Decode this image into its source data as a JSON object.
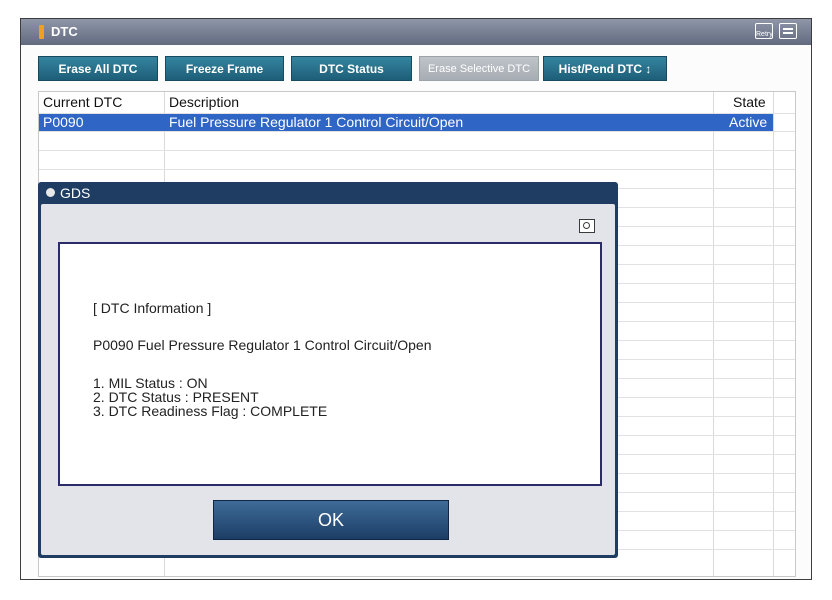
{
  "window": {
    "title": "DTC",
    "retry_icon_label": "Retry"
  },
  "toolbar": {
    "buttons": [
      {
        "label": "Erase All DTC",
        "enabled": true
      },
      {
        "label": "Freeze Frame",
        "enabled": true
      },
      {
        "label": "DTC Status",
        "enabled": true
      },
      {
        "label": "Erase Selective DTC",
        "enabled": false
      },
      {
        "label": "Hist/Pend DTC ↕",
        "enabled": true
      }
    ]
  },
  "table": {
    "columns": [
      "Current DTC",
      "Description",
      "State"
    ],
    "rows": [
      {
        "code": "P0090",
        "description": "Fuel Pressure Regulator 1 Control Circuit/Open",
        "state": "Active",
        "selected": true
      }
    ]
  },
  "dialog": {
    "title": "GDS",
    "heading": "[ DTC Information ]",
    "dtc_line": "P0090 Fuel Pressure Regulator 1 Control Circuit/Open",
    "status_items": [
      "1. MIL Status : ON",
      "2. DTC Status : PRESENT",
      "3. DTC Readiness Flag : COMPLETE"
    ],
    "ok_label": "OK"
  },
  "colors": {
    "accent_button": "#1d5e78",
    "selection": "#2f65c4",
    "dialog_frame": "#1f3d63",
    "title_mark": "#f0a020"
  },
  "icons": [
    "retry-icon",
    "menu-icon",
    "gds-icon",
    "camera-icon"
  ]
}
